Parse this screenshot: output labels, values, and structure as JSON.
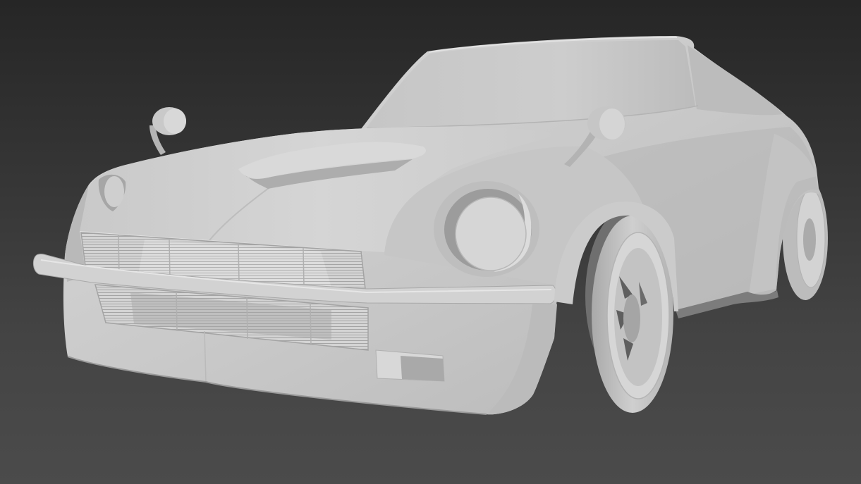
{
  "colors": {
    "background_top": "#262626",
    "background_mid": "#444444",
    "background_bottom": "#4b4b4b",
    "clay_light": "#d8d8d8",
    "clay_base": "#c9c9c9",
    "clay_shade": "#b6b6b6",
    "recess_dark": "#6f6f6f"
  }
}
